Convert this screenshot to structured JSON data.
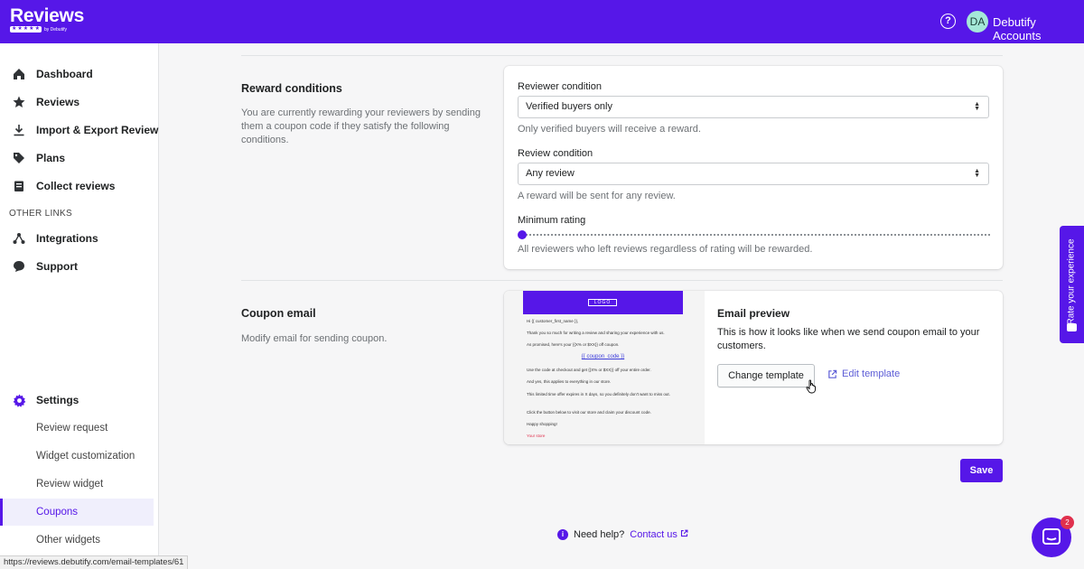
{
  "header": {
    "brand": "Reviews",
    "brand_by": "by Debutify",
    "help_icon": "question-circle-icon",
    "avatar_initials": "DA",
    "account_name": "Debutify Accounts",
    "brand_color": "#5617e8"
  },
  "sidebar": {
    "main": [
      {
        "label": "Dashboard",
        "icon": "home-icon"
      },
      {
        "label": "Reviews",
        "icon": "star-icon"
      },
      {
        "label": "Import & Export Review",
        "icon": "download-icon"
      },
      {
        "label": "Plans",
        "icon": "tag-icon"
      },
      {
        "label": "Collect reviews",
        "icon": "clipboard-icon"
      }
    ],
    "other_links_label": "OTHER LINKS",
    "other": [
      {
        "label": "Integrations",
        "icon": "share-nodes-icon"
      },
      {
        "label": "Support",
        "icon": "chat-bubble-icon"
      }
    ],
    "settings_label": "Settings",
    "settings_items": [
      {
        "label": "Review request"
      },
      {
        "label": "Widget customization"
      },
      {
        "label": "Review widget"
      },
      {
        "label": "Coupons"
      },
      {
        "label": "Other widgets"
      }
    ],
    "active_item": "Coupons"
  },
  "reward_conditions": {
    "title": "Reward conditions",
    "description": "You are currently rewarding your reviewers by sending them a coupon code if they satisfy the following conditions.",
    "reviewer_condition_label": "Reviewer condition",
    "reviewer_condition_value": "Verified buyers only",
    "reviewer_condition_help": "Only verified buyers will receive a reward.",
    "review_condition_label": "Review condition",
    "review_condition_value": "Any review",
    "review_condition_help": "A reward will be sent for any review.",
    "minimum_rating_label": "Minimum rating",
    "minimum_rating_value": 0,
    "minimum_rating_help": "All reviewers who left reviews regardless of rating will be rewarded."
  },
  "coupon_email": {
    "title": "Coupon email",
    "description": "Modify email for sending coupon.",
    "thumb": {
      "logo": "LOGO",
      "greeting": "Hi {{ customer_first_name }},",
      "line1": "Thank you so much for writing a review and sharing your experience with us.",
      "line2": "As promised, here's your {{X% or $XX}} off coupon.",
      "coupon": "{{ coupon_code }}",
      "line3": "Use the code at checkout and get {{X% or $XX}} off your entire order.",
      "line4": "And yes, this applies to everything in our store.",
      "line5": "This limited time offer expires in X days, so you definitely don't want to miss out.",
      "line6": "Click the button below to visit our store and claim your discount code.",
      "line7": "Happy shopping!",
      "line8": "Your store"
    },
    "preview_title": "Email preview",
    "preview_desc": "This is how it looks like when we send coupon email to your customers.",
    "change_template": "Change template",
    "edit_template": "Edit template"
  },
  "save_label": "Save",
  "help": {
    "text": "Need help?",
    "link": "Contact us"
  },
  "rate_tab": "Rate your experience",
  "chat_badge": "2",
  "status_url": "https://reviews.debutify.com/email-templates/61"
}
